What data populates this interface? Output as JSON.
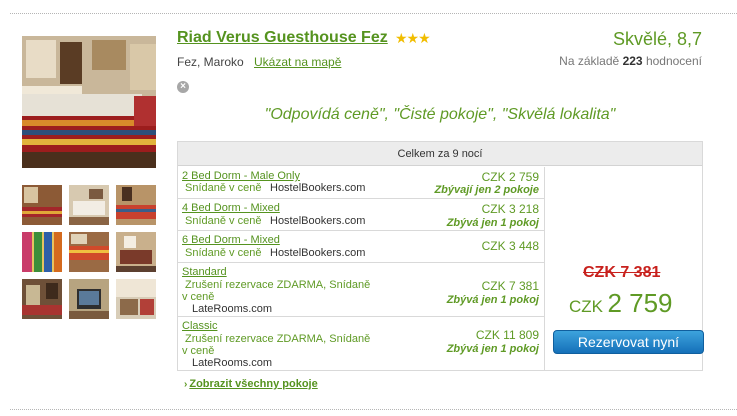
{
  "hotel": {
    "name": "Riad Verus Guesthouse Fez",
    "stars": "★★★",
    "location": "Fez, Maroko",
    "map_link": "Ukázat na mapě",
    "rating_text": "Skvělé, 8,7",
    "reviews_prefix": "Na základě",
    "reviews_count": "223",
    "reviews_suffix": "hodnocení",
    "tagline": "\"Odpovídá ceně\",  \"Čisté pokoje\",  \"Skvělá lokalita\""
  },
  "table": {
    "header": "Celkem za 9 nocí",
    "rooms": [
      {
        "name": "2 Bed Dorm - Male Only",
        "sub": "Snídaně v ceně",
        "provider": "HostelBookers.com",
        "price": "CZK 2 759",
        "note": "Zbývají jen 2 pokoje"
      },
      {
        "name": "4 Bed Dorm - Mixed",
        "sub": "Snídaně v ceně",
        "provider": "HostelBookers.com",
        "price": "CZK 3 218",
        "note": "Zbývá jen 1 pokoj"
      },
      {
        "name": "6 Bed Dorm - Mixed",
        "sub": "Snídaně v ceně",
        "provider": "HostelBookers.com",
        "price": "CZK 3 448",
        "note": ""
      },
      {
        "name": "Standard",
        "sub": "Zrušení rezervace ZDARMA, Snídaně",
        "sub2": "v ceně",
        "provider": "LateRooms.com",
        "price": "CZK 7 381",
        "note": "Zbývá jen 1 pokoj"
      },
      {
        "name": "Classic",
        "sub": "Zrušení rezervace ZDARMA, Snídaně",
        "sub2": "v ceně",
        "provider": "LateRooms.com",
        "price": "CZK 11 809",
        "note": "Zbývá jen 1 pokoj"
      }
    ],
    "old_price": "CZK 7 381",
    "new_price_currency": "CZK",
    "new_price_amount": "2 759",
    "book_button": "Rezervovat nyní"
  },
  "show_all_rooms": "Zobrazit všechny pokoje",
  "icons": {
    "close": "close-icon",
    "chevron": "chevron-right-icon"
  },
  "colors": {
    "accent_green": "#55931f",
    "price_red": "#c8211d",
    "button_blue": "#1e7fc6",
    "star_yellow": "#f1bd00"
  }
}
